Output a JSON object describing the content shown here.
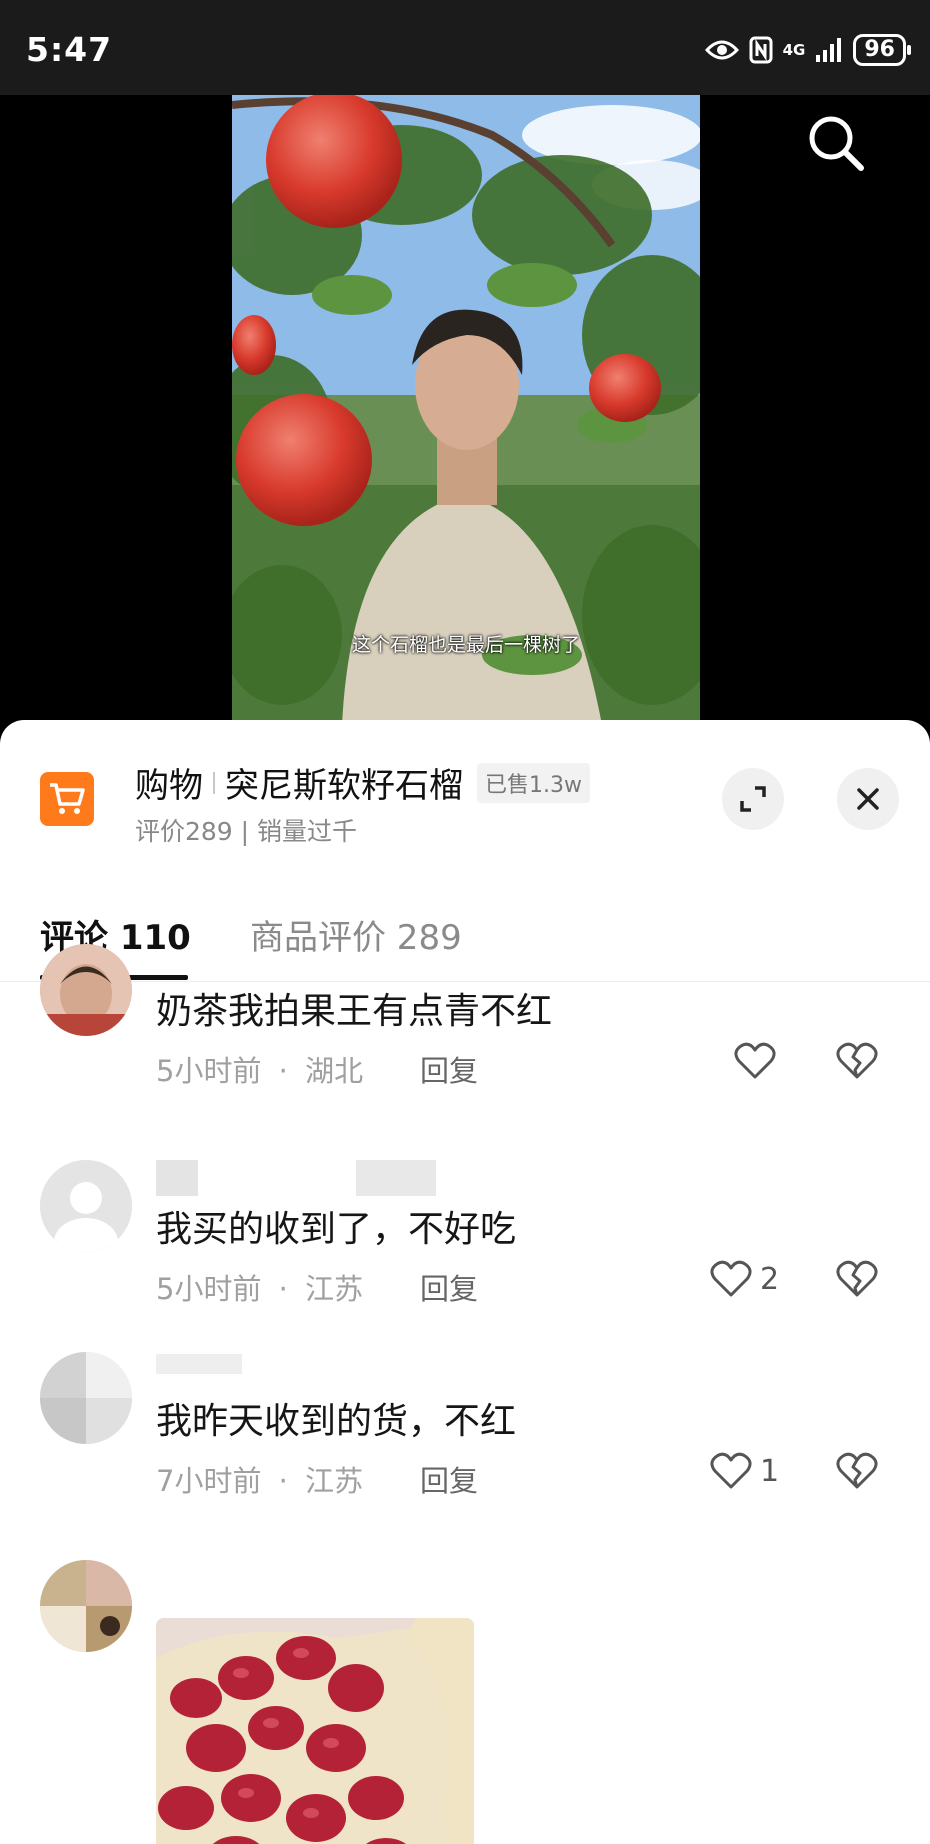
{
  "status_bar": {
    "time": "5:47",
    "network": "4G",
    "battery": "96"
  },
  "video": {
    "caption": "这个石榴也是最后一棵树了"
  },
  "product": {
    "shop_label": "购物",
    "name": "突尼斯软籽石榴",
    "sold": "已售1.3w",
    "subtitle": "评价289 | 销量过千"
  },
  "tabs": [
    {
      "label": "评论 110",
      "active": true
    },
    {
      "label": "商品评价 289",
      "active": false
    }
  ],
  "comments": [
    {
      "text": "奶茶我拍果王有点青不红",
      "time": "5小时前",
      "location": "湖北",
      "reply": "回复",
      "likes": ""
    },
    {
      "text": "我买的收到了，不好吃",
      "time": "5小时前",
      "location": "江苏",
      "reply": "回复",
      "likes": "2"
    },
    {
      "text": "我昨天收到的货，不红",
      "time": "7小时前",
      "location": "江苏",
      "reply": "回复",
      "likes": "1"
    }
  ],
  "meta_separator": "·",
  "colors": {
    "accent": "#ff7a1a",
    "text": "#161616",
    "meta": "#a0a0a0"
  },
  "icons": [
    "search-icon",
    "cart-icon",
    "expand-icon",
    "close-icon",
    "heart-icon",
    "broken-heart-icon",
    "eye-icon",
    "nfc-icon",
    "signal-icon"
  ]
}
